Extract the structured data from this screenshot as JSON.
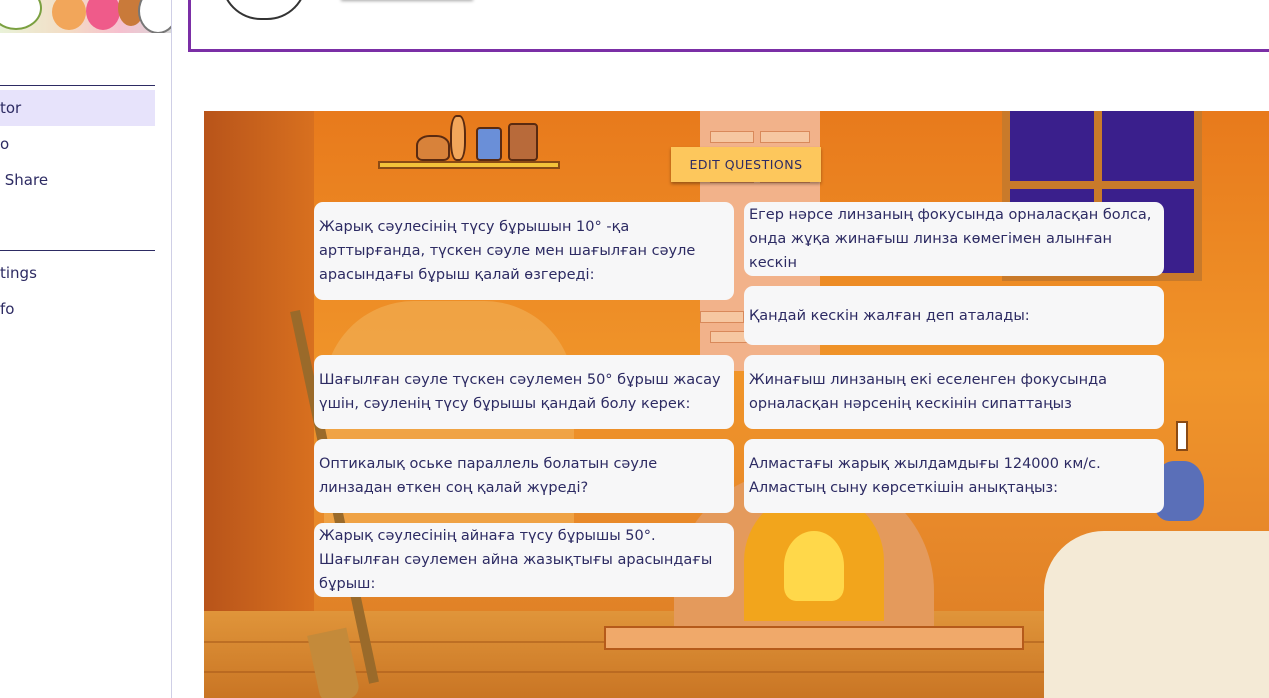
{
  "sidebar": {
    "items": [
      {
        "label": "tor",
        "active": true
      },
      {
        "label": "o",
        "active": false
      },
      {
        "label": " Share",
        "active": false
      },
      {
        "label": "tings",
        "active": false
      },
      {
        "label": "fo",
        "active": false
      }
    ]
  },
  "toolbar": {
    "edit_questions_label": "EDIT QUESTIONS"
  },
  "questions": [
    "Жарық сәулесінің түсу бұрышын 10° -қа арттырғанда, түскен сәуле мен шағылған сәуле арасындағы бұрыш қалай өзгереді:",
    "Шағылған сәуле түскен сәулемен 50° бұрыш жасау үшін, сәуленің түсу бұрышы қандай болу керек:",
    "Оптикалық оське параллель болатын сәуле линзадан өткен соң қалай жүреді?",
    "Жарық сәулесінің айнаға түсу бұрышы 50°. Шағылған сәулемен айна жазықтығы арасындағы бұрыш:",
    "Егер нәрсе линзаның фокусында орналасқан болса, онда жұқа жинағыш линза көмегімен алынған кескін",
    "Қандай кескін жалған деп аталады:",
    "Жинағыш линзаның екі еселенген фокусында орналасқан нәрсенің кескінін сипаттаңыз",
    "Алмастағы жарық жылдамдығы 124000 км/с. Алмастың сыну көрсеткішін анықтаңыз:"
  ],
  "colors": {
    "accent_purple": "#7b2fa6",
    "button_yellow": "#fdc75c",
    "text_navy": "#2d2b63",
    "sidebar_active": "#e7e3fb"
  }
}
